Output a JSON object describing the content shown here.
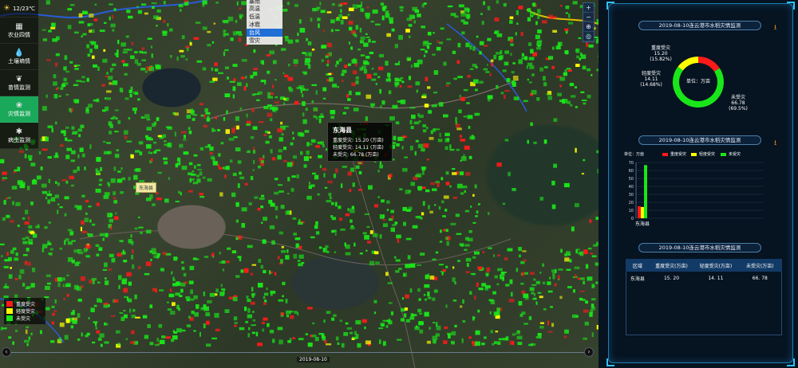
{
  "weather": {
    "icon": "sun-icon",
    "text": "12/23℃"
  },
  "toolbar": [
    {
      "icon": "grid-icon",
      "label": "农业四情",
      "active": false
    },
    {
      "icon": "soil-drop-icon",
      "label": "土壤墒情",
      "active": false
    },
    {
      "icon": "seedling-icon",
      "label": "苗情监测",
      "active": false
    },
    {
      "icon": "disaster-icon",
      "label": "灾情监测",
      "active": true
    },
    {
      "icon": "bug-icon",
      "label": "病虫监测",
      "active": false
    }
  ],
  "dropdown": {
    "items": [
      "暴雨",
      "高温",
      "低温",
      "冰雹",
      "台风",
      "雪灾"
    ],
    "selected": "台风"
  },
  "tooltip": {
    "title": "东海县",
    "rows": [
      "重度受灾: 15.20 (万亩)",
      "轻度受灾: 14.11 (万亩)",
      "未受灾: 66.78 (万亩)"
    ]
  },
  "map_label": "东海县",
  "zoom_controls": [
    "+",
    "−",
    "⊕",
    "◎"
  ],
  "legend": [
    {
      "label": "重度受灾",
      "color": "#ff1a1a"
    },
    {
      "label": "轻度受灾",
      "color": "#ffff00"
    },
    {
      "label": "未受灾",
      "color": "#19e619"
    }
  ],
  "timeline": {
    "date": "2019-08-10",
    "prev": "‹",
    "next": "›"
  },
  "panel1": {
    "title": "2019-08-10连云港市水稻灾情监测",
    "center": "单位：万亩",
    "slices": [
      {
        "label": "重度受灾",
        "value": "15.20",
        "pct": "(15.82%)"
      },
      {
        "label": "轻度受灾",
        "value": "14.11",
        "pct": "(14.68%)"
      },
      {
        "label": "未受灾",
        "value": "66.78",
        "pct": "(69.5%)"
      }
    ]
  },
  "panel2": {
    "title": "2019-08-10连云港市水稻灾情监测",
    "unit": "单位：万亩",
    "legend": [
      "重度受灾",
      "轻度受灾",
      "未受灾"
    ]
  },
  "panel3": {
    "title": "2019-08-10连云港市水稻灾情监测",
    "headers": [
      "区域",
      "重度受灾(万亩)",
      "轻度受灾(万亩)",
      "未受灾(万亩)"
    ],
    "rows": [
      [
        "东海县",
        "15. 20",
        "14. 11",
        "66. 78"
      ]
    ]
  },
  "colors": {
    "severe": "#ff1a1a",
    "light": "#ffff00",
    "none": "#19e619",
    "accent": "#2fc3ff"
  },
  "chart_data": [
    {
      "type": "pie",
      "title": "2019-08-10连云港市水稻灾情监测",
      "categories": [
        "重度受灾",
        "轻度受灾",
        "未受灾"
      ],
      "values": [
        15.2,
        14.11,
        66.78
      ],
      "percent": [
        15.82,
        14.68,
        69.5
      ]
    },
    {
      "type": "bar",
      "title": "2019-08-10连云港市水稻灾情监测",
      "categories": [
        "东海县"
      ],
      "series": [
        {
          "name": "重度受灾",
          "values": [
            15.2
          ]
        },
        {
          "name": "轻度受灾",
          "values": [
            14.11
          ]
        },
        {
          "name": "未受灾",
          "values": [
            66.78
          ]
        }
      ],
      "ylabel": "单位：万亩",
      "ylim": [
        0,
        70
      ],
      "yticks": [
        "0",
        "10",
        "20",
        "30",
        "40",
        "50",
        "60",
        "70"
      ],
      "legend_position": "top"
    }
  ]
}
